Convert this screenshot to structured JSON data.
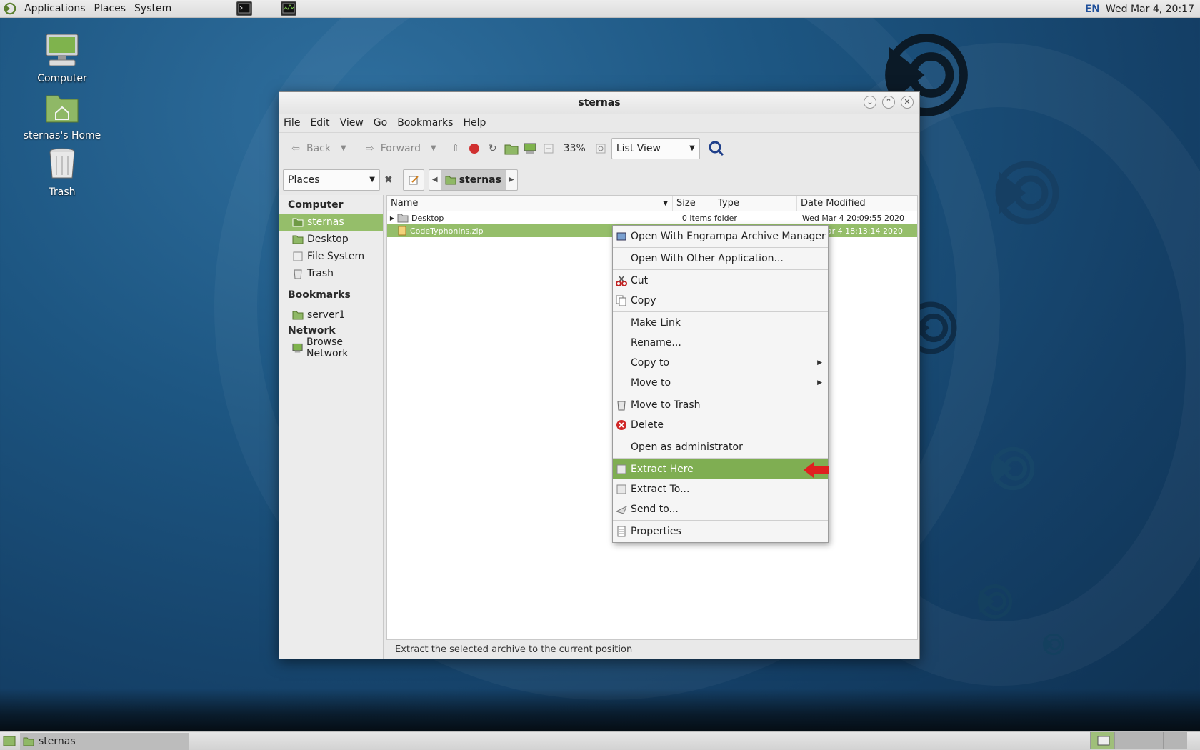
{
  "top_panel": {
    "menus": [
      "Applications",
      "Places",
      "System"
    ],
    "lang": "EN",
    "clock": "Wed Mar  4, 20:17"
  },
  "desktop_icons": [
    {
      "label": "Computer"
    },
    {
      "label": "sternas's Home"
    },
    {
      "label": "Trash"
    }
  ],
  "window": {
    "title": "sternas",
    "menubar": [
      "File",
      "Edit",
      "View",
      "Go",
      "Bookmarks",
      "Help"
    ],
    "toolbar": {
      "back": "Back",
      "forward": "Forward",
      "zoom": "33%",
      "view_mode": "List View"
    },
    "location": {
      "places_label": "Places",
      "crumb": "sternas"
    },
    "sidebar": {
      "sections": [
        {
          "title": "Computer",
          "items": [
            "sternas",
            "Desktop",
            "File System",
            "Trash"
          ]
        },
        {
          "title": "Bookmarks",
          "items": [
            "server1"
          ]
        },
        {
          "title": "Network",
          "items": [
            "Browse Network"
          ]
        }
      ],
      "active": "sternas"
    },
    "columns": [
      "Name",
      "Size",
      "Type",
      "Date Modified"
    ],
    "files": [
      {
        "name": "Desktop",
        "size": "0 items",
        "type": "folder",
        "date": "Wed Mar  4 20:09:55 2020"
      },
      {
        "name": "CodeTyphonIns.zip",
        "size": "",
        "type": "",
        "date": "Wed Mar  4 18:13:14 2020"
      }
    ],
    "status": "Extract the selected archive to the current position"
  },
  "context_menu": {
    "items": [
      "Open With Engrampa Archive Manager",
      "Open With Other Application...",
      "Cut",
      "Copy",
      "Make Link",
      "Rename...",
      "Copy to",
      "Move to",
      "Move to Trash",
      "Delete",
      "Open as administrator",
      "Extract Here",
      "Extract To...",
      "Send to...",
      "Properties"
    ],
    "highlighted": "Extract Here"
  },
  "bottom_panel": {
    "task": "sternas"
  },
  "colors": {
    "selection": "#95be6a",
    "menu_highlight": "#7fae52",
    "arrow": "#e02020"
  }
}
